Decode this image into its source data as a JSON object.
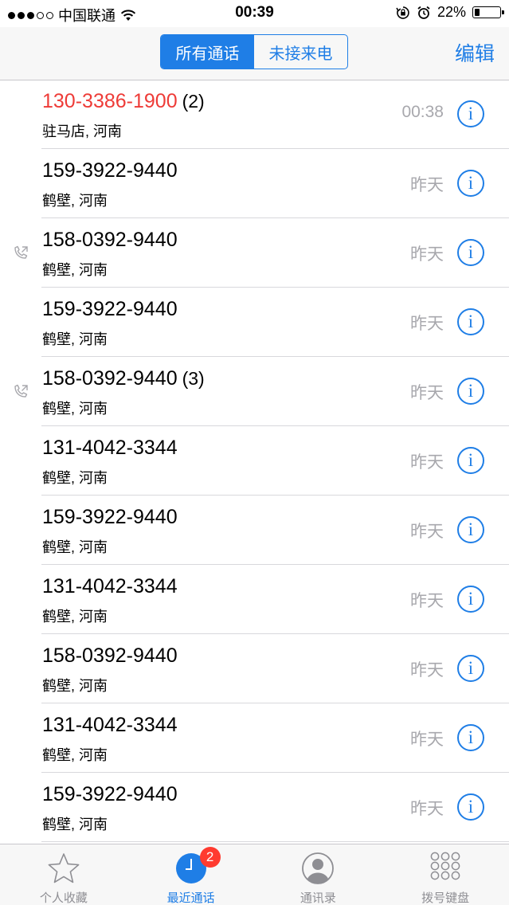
{
  "status_bar": {
    "carrier": "中国联通",
    "time": "00:39",
    "battery_percent": "22%",
    "battery_level": 0.22,
    "signal_bars_filled": 3,
    "signal_bars_total": 5
  },
  "nav": {
    "segments": [
      "所有通话",
      "未接来电"
    ],
    "active_segment": 0,
    "edit_label": "编辑"
  },
  "calls": [
    {
      "number": "130-3386-1900",
      "count": "(2)",
      "location": "驻马店, 河南",
      "time": "00:38",
      "missed": true,
      "outgoing": false
    },
    {
      "number": "159-3922-9440",
      "count": "",
      "location": "鹤壁, 河南",
      "time": "昨天",
      "missed": false,
      "outgoing": false
    },
    {
      "number": "158-0392-9440",
      "count": "",
      "location": "鹤壁, 河南",
      "time": "昨天",
      "missed": false,
      "outgoing": true
    },
    {
      "number": "159-3922-9440",
      "count": "",
      "location": "鹤壁, 河南",
      "time": "昨天",
      "missed": false,
      "outgoing": false
    },
    {
      "number": "158-0392-9440",
      "count": "(3)",
      "location": "鹤壁, 河南",
      "time": "昨天",
      "missed": false,
      "outgoing": true
    },
    {
      "number": "131-4042-3344",
      "count": "",
      "location": "鹤壁, 河南",
      "time": "昨天",
      "missed": false,
      "outgoing": false
    },
    {
      "number": "159-3922-9440",
      "count": "",
      "location": "鹤壁, 河南",
      "time": "昨天",
      "missed": false,
      "outgoing": false
    },
    {
      "number": "131-4042-3344",
      "count": "",
      "location": "鹤壁, 河南",
      "time": "昨天",
      "missed": false,
      "outgoing": false
    },
    {
      "number": "158-0392-9440",
      "count": "",
      "location": "鹤壁, 河南",
      "time": "昨天",
      "missed": false,
      "outgoing": false
    },
    {
      "number": "131-4042-3344",
      "count": "",
      "location": "鹤壁, 河南",
      "time": "昨天",
      "missed": false,
      "outgoing": false
    },
    {
      "number": "159-3922-9440",
      "count": "",
      "location": "鹤壁, 河南",
      "time": "昨天",
      "missed": false,
      "outgoing": false
    }
  ],
  "tabs": [
    {
      "label": "个人收藏",
      "icon": "star-icon",
      "active": false,
      "badge": ""
    },
    {
      "label": "最近通话",
      "icon": "clock-icon",
      "active": true,
      "badge": "2"
    },
    {
      "label": "通讯录",
      "icon": "contacts-icon",
      "active": false,
      "badge": ""
    },
    {
      "label": "拨号键盘",
      "icon": "keypad-icon",
      "active": false,
      "badge": ""
    }
  ],
  "colors": {
    "accent": "#1f7ee6",
    "missed": "#ee3b37",
    "secondary_text": "#a8a8ad",
    "badge": "#ff3b30"
  }
}
